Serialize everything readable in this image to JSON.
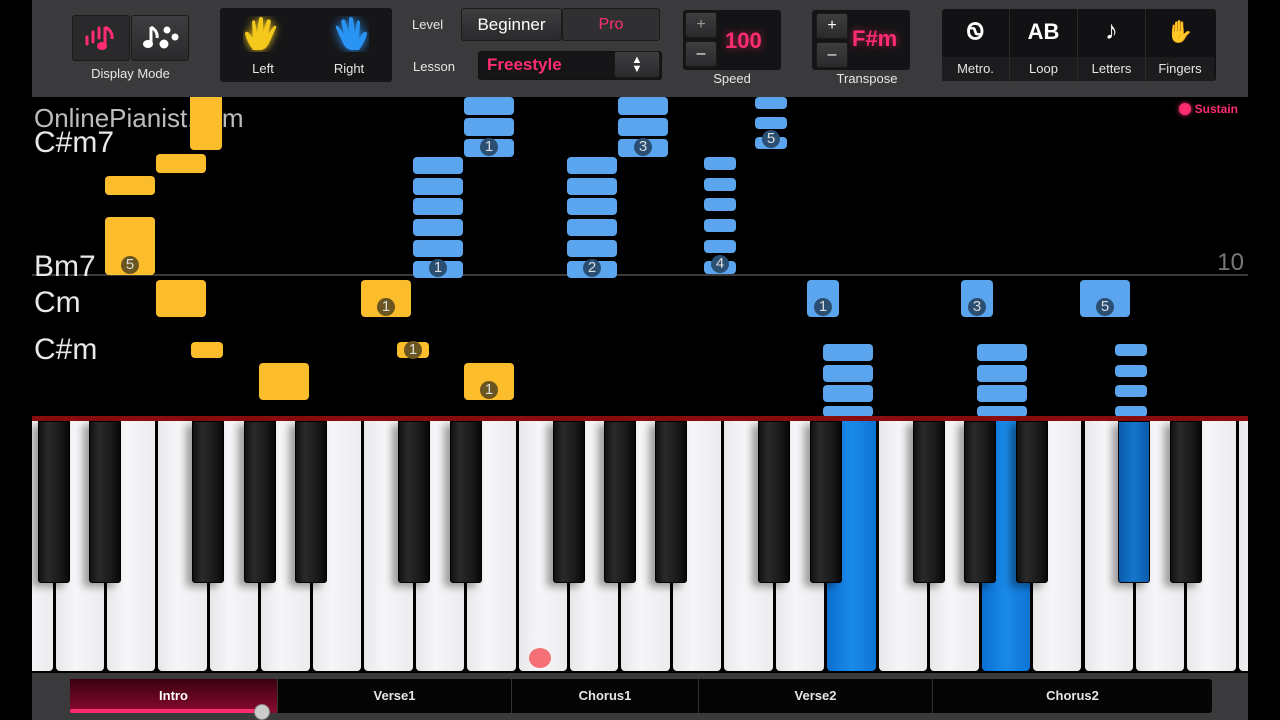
{
  "toolbar": {
    "display_mode_label": "Display Mode",
    "hands": {
      "left": "Left",
      "right": "Right"
    },
    "level_label": "Level",
    "level_options": [
      "Beginner",
      "Pro"
    ],
    "level_selected": "Beginner",
    "lesson_label": "Lesson",
    "lesson_value": "Freestyle",
    "speed": {
      "label": "Speed",
      "value": "100",
      "plus": "+",
      "minus": "–"
    },
    "transpose": {
      "label": "Transpose",
      "value": "F#m",
      "plus": "+",
      "minus": "–"
    },
    "tools": [
      {
        "label": "Metro.",
        "icon": "Ꮻ"
      },
      {
        "label": "Loop",
        "icon": "AB"
      },
      {
        "label": "Letters",
        "icon": "♪"
      },
      {
        "label": "Fingers",
        "icon": "✋"
      }
    ]
  },
  "notes_area": {
    "watermark": "OnlinePianist.com",
    "sustain_label": "Sustain",
    "measure_number": "10",
    "chords": [
      "C#m7",
      "Bm7",
      "Cm",
      "C#m"
    ],
    "left_hand_color": "#fbbd2c",
    "right_hand_color": "#5aa5ee",
    "fingers": {
      "lh": [
        "5",
        "1",
        "1",
        "1"
      ],
      "rh_upper": [
        "1",
        "3",
        "5"
      ],
      "rh_mid": [
        "1",
        "2",
        "4"
      ],
      "rh_lower": [
        "1",
        "3",
        "5"
      ]
    }
  },
  "sections": [
    {
      "label": "Intro",
      "active": true
    },
    {
      "label": "Verse1",
      "active": false
    },
    {
      "label": "Chorus1",
      "active": false
    },
    {
      "label": "Verse2",
      "active": false
    },
    {
      "label": "Chorus2",
      "active": false
    }
  ],
  "playback_progress_of_section": 0.92,
  "accent_color": "#ff2d6f"
}
